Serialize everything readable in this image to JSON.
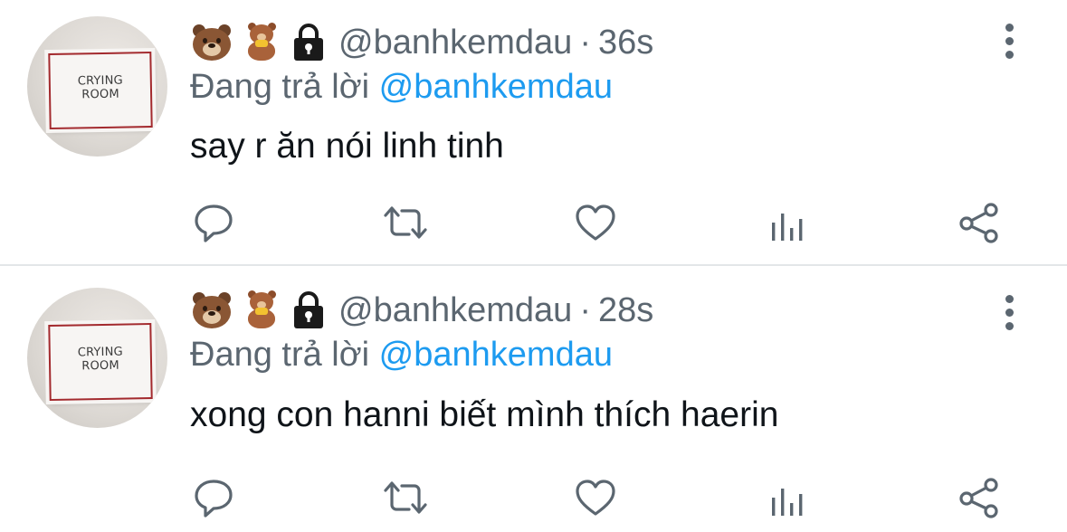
{
  "tweets": [
    {
      "avatar_sign": [
        "CRYING",
        "ROOM"
      ],
      "name_emojis": [
        "bear-face-icon",
        "teddy-bear-icon",
        "lock-icon"
      ],
      "handle": "@banhkemdau",
      "separator": "·",
      "time": "36s",
      "replying_prefix": "Đang trả lời",
      "replying_to": "@banhkemdau",
      "text": "say r ăn nói linh tinh",
      "actions": [
        "reply-icon",
        "retweet-icon",
        "like-icon",
        "analytics-icon",
        "share-icon"
      ]
    },
    {
      "avatar_sign": [
        "CRYING",
        "ROOM"
      ],
      "name_emojis": [
        "bear-face-icon",
        "teddy-bear-icon",
        "lock-icon"
      ],
      "handle": "@banhkemdau",
      "separator": "·",
      "time": "28s",
      "replying_prefix": "Đang trả lời",
      "replying_to": "@banhkemdau",
      "text": "xong con hanni biết mình thích haerin",
      "actions": [
        "reply-icon",
        "retweet-icon",
        "like-icon",
        "analytics-icon",
        "share-icon"
      ]
    }
  ],
  "colors": {
    "secondary_text": "#5b6670",
    "primary_text": "#0f1419",
    "mention": "#1d9bf0",
    "divider": "#e3e6e8",
    "sign_border": "#a32a2e"
  }
}
